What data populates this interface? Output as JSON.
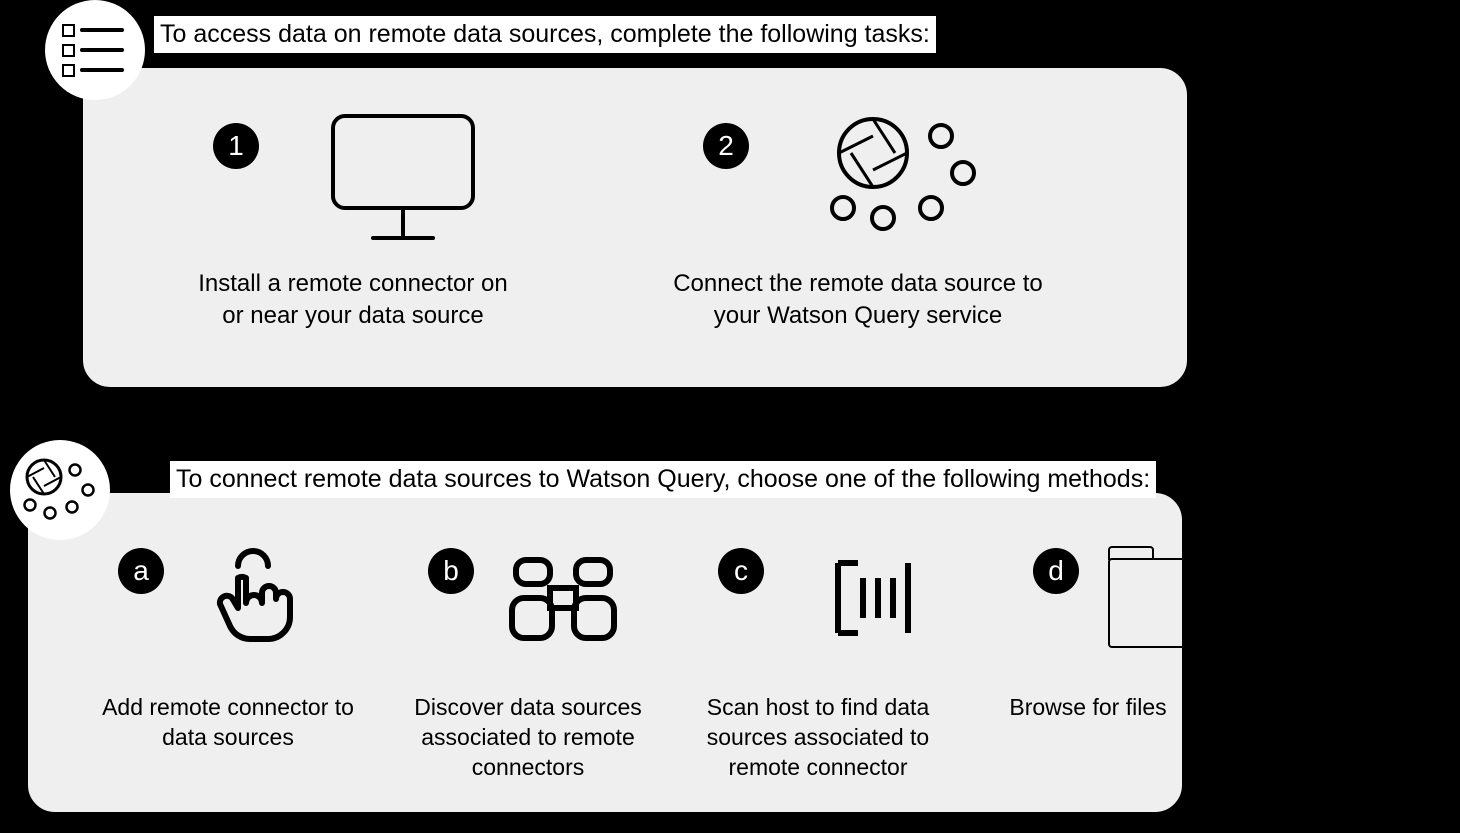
{
  "section1": {
    "title": "To access data on remote data sources, complete the following tasks:",
    "steps": [
      {
        "badge": "1",
        "text": "Install a remote connector on or near your data source"
      },
      {
        "badge": "2",
        "text": "Connect the remote data source to your Watson Query service"
      }
    ]
  },
  "section2": {
    "title": "To connect remote data sources to Watson Query, choose one of the following methods:",
    "methods": [
      {
        "badge": "a",
        "text": "Add remote connector to data sources"
      },
      {
        "badge": "b",
        "text": "Discover data sources associated to remote connectors"
      },
      {
        "badge": "c",
        "text": "Scan host to find data sources associated to remote connector"
      },
      {
        "badge": "d",
        "text": "Browse for files"
      }
    ]
  }
}
